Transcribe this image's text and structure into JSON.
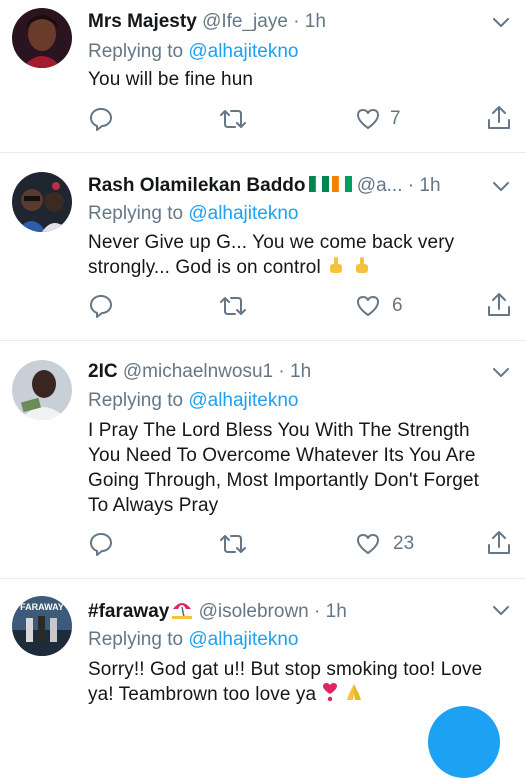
{
  "tweets": [
    {
      "name": "Mrs Majesty",
      "handle": "@Ife_jaye",
      "time": "· 1h",
      "replying_prefix": "Replying to",
      "replying_to": "@alhajitekno",
      "lines": [
        "You will be fine hun"
      ],
      "like_count": "7",
      "retweet_count": "",
      "reply_count": ""
    },
    {
      "name": "Rash Olamilekan Baddo",
      "handle": "@a...",
      "time": "· 1h",
      "replying_prefix": "Replying to",
      "replying_to": "@alhajitekno",
      "lines": [
        "Never Give up G...  You we come back very",
        "strongly...  God is on control"
      ],
      "like_count": "6",
      "retweet_count": "",
      "reply_count": ""
    },
    {
      "name": "2IC",
      "handle": "@michaelnwosu1",
      "time": "· 1h",
      "replying_prefix": "Replying to",
      "replying_to": "@alhajitekno",
      "lines": [
        "I Pray The Lord Bless You With The Strength",
        "You Need To Overcome Whatever Its You Are",
        "Going Through, Most Importantly Don't Forget",
        "To Always Pray"
      ],
      "like_count": "23",
      "retweet_count": "",
      "reply_count": ""
    },
    {
      "name": "#faraway",
      "handle": "@isolebrown",
      "time": "· 1h",
      "replying_prefix": "Replying to",
      "replying_to": "@alhajitekno",
      "lines": [
        "Sorry!! God gat u!! But stop smoking too! Love",
        "ya! Teambrown too love ya"
      ],
      "avatar_text": "FARAWAY"
    }
  ],
  "colors": {
    "accent": "#1da1f2",
    "secondary_text": "#657786",
    "primary_text": "#14171a",
    "divider": "#e6ecf0",
    "heart_emoji": "#e0245e",
    "hands_emoji": "#f5c33b"
  },
  "icons": [
    "reply-icon",
    "retweet-icon",
    "like-icon",
    "share-icon",
    "chevron-down-icon",
    "nigeria-flag-icon",
    "beach-umbrella-emoji",
    "pointing-up-emoji",
    "heart-exclamation-emoji",
    "folded-hands-emoji",
    "compose-fab"
  ]
}
